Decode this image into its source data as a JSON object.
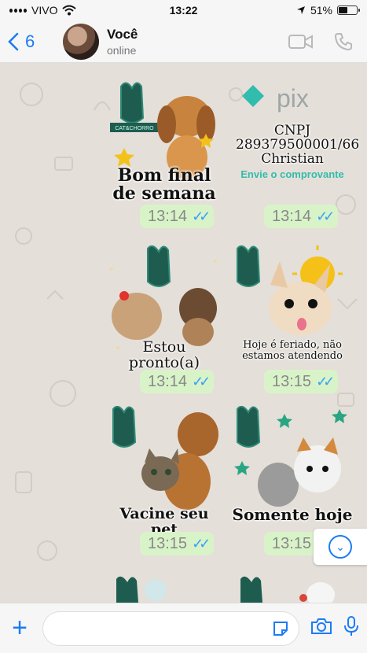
{
  "status_bar": {
    "carrier": "VIVO",
    "time": "13:22",
    "battery": "51%",
    "battery_level": 0.51
  },
  "header": {
    "back_count": "6",
    "contact_name": "Você",
    "contact_status": "online"
  },
  "stickers": [
    {
      "caption": "Bom final de semana",
      "time": "13:14",
      "brand": "CAT&CHORRO"
    },
    {
      "caption": "CNPJ 289379500001/66 Christian",
      "note": "Envie o comprovante",
      "time": "13:14",
      "brand": "pix"
    },
    {
      "caption": "Estou pronto(a)",
      "time": "13:14",
      "brand": "CAT&CHORRO"
    },
    {
      "caption": "Hoje é feriado, não estamos atendendo",
      "time": "13:15",
      "brand": "CAT&CHORRO"
    },
    {
      "caption": "Vacine seu pet",
      "time": "13:15",
      "brand": "CAT&CHORRO"
    },
    {
      "caption": "Somente hoje",
      "time": "13:15",
      "brand": "CAT&CHORRO"
    }
  ],
  "input": {
    "placeholder": ""
  },
  "colors": {
    "accent": "#1b7cf5",
    "bubble": "#d9f3c9",
    "pix": "#32bcad",
    "brand": "#1e6b5c"
  },
  "icons": [
    "back-chevron-icon",
    "video-call-icon",
    "phone-icon",
    "plus-icon",
    "sticker-icon",
    "camera-icon",
    "microphone-icon",
    "chevron-down-icon",
    "wifi-icon",
    "location-icon"
  ]
}
